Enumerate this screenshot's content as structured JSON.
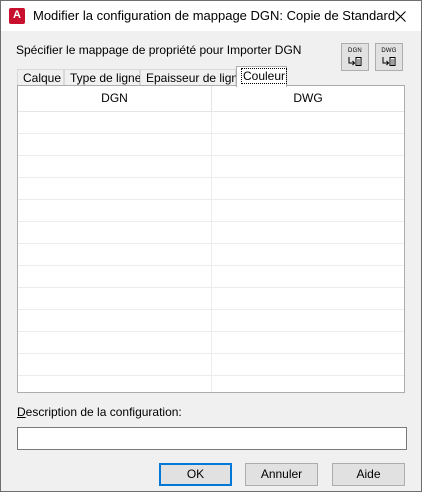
{
  "window": {
    "title": "Modifier la configuration de mappage DGN: Copie de Standard",
    "app_icon_letter": "A"
  },
  "header": {
    "specify_label": "Spécifier le mappage de propriété pour Importer DGN",
    "dgn_button_label": "DGN",
    "dwg_button_label": "DWG"
  },
  "tabs": [
    {
      "label": "Calque",
      "active": false
    },
    {
      "label": "Type de ligne",
      "active": false
    },
    {
      "label": "Epaisseur de ligne",
      "active": false
    },
    {
      "label": "Couleur",
      "active": true
    }
  ],
  "grid": {
    "columns": [
      "DGN",
      "DWG"
    ],
    "rows": []
  },
  "description": {
    "label_prefix": "D",
    "label_rest": "escription de la configuration:",
    "value": ""
  },
  "buttons": {
    "ok": "OK",
    "cancel": "Annuler",
    "help": "Aide"
  }
}
